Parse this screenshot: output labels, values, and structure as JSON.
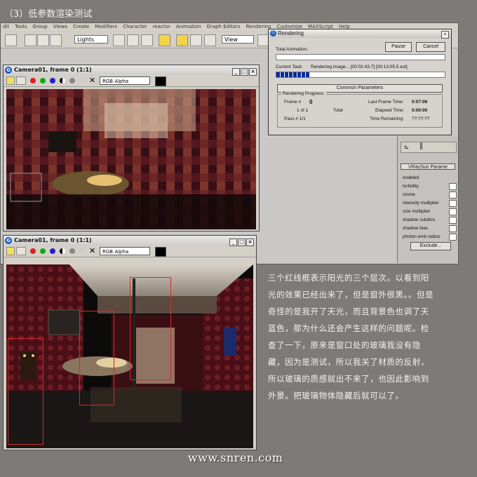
{
  "heading": "（3）低参数渲染测试",
  "menu": [
    "dit",
    "Tools",
    "Group",
    "Views",
    "Create",
    "Modifiers",
    "Character",
    "reactor",
    "Animation",
    "Graph Editors",
    "Rendering",
    "Customize",
    "MAXScript",
    "Help"
  ],
  "toolbar": {
    "filter_select": "Lights",
    "view_select": "View"
  },
  "top_vfb": {
    "title": "Camera01, frame 0 (1:1)",
    "channel": "RGB Alpha"
  },
  "bottom_vfb": {
    "title": "Camera01, frame 0 (1:1)",
    "channel": "RGB Alpha"
  },
  "rendering_dialog": {
    "title": "Rendering",
    "pause_label": "Pause",
    "cancel_label": "Cancel",
    "total_animation_label": "Total Animation:",
    "current_task_label": "Current Task:",
    "current_task_value": "Rendering image... [00:02:43.7] [00:13:05.5 est]",
    "current_task_progress": 0.2,
    "common_parameters_label": "Common Parameters",
    "progress_group_label": "Rendering Progress:",
    "frame_label": "Frame #",
    "frame_value": "0",
    "of_label": "1 of 1",
    "total_label": "Total",
    "pass_label": "Pass # 1/1",
    "last_frame_time_label": "Last Frame Time:",
    "last_frame_time_value": "0:07:06",
    "elapsed_time_label": "Elapsed Time:",
    "elapsed_time_value": "0:00:00",
    "time_remaining_label": "Time Remaining:",
    "time_remaining_value": "??:??:??"
  },
  "vraysun_panel": {
    "rollout_label": "VRaySun Parame",
    "params": [
      "enabled",
      "turbidity",
      "ozone",
      "intensity multiplier",
      "size multiplier",
      "shadow subdivs",
      "shadow bias",
      "photon emit radius"
    ],
    "exclude_label": "Exclude..."
  },
  "description": "三个红线框表示阳光的三个层次。以看到阳光的效果已经出来了，但是窗外很黑。。但是奇怪的是我开了天光，而且背景色也调了天蓝色，那为什么还会产生这样的问题呢。检查了一下，原来是窗口处的玻璃我没有隐藏，因为是测试，所以我关了材质的反射，所以玻璃的质感就出不来了，也因此影响到外景。把玻璃物体隐藏后就可以了。",
  "url": "www.snren.com"
}
